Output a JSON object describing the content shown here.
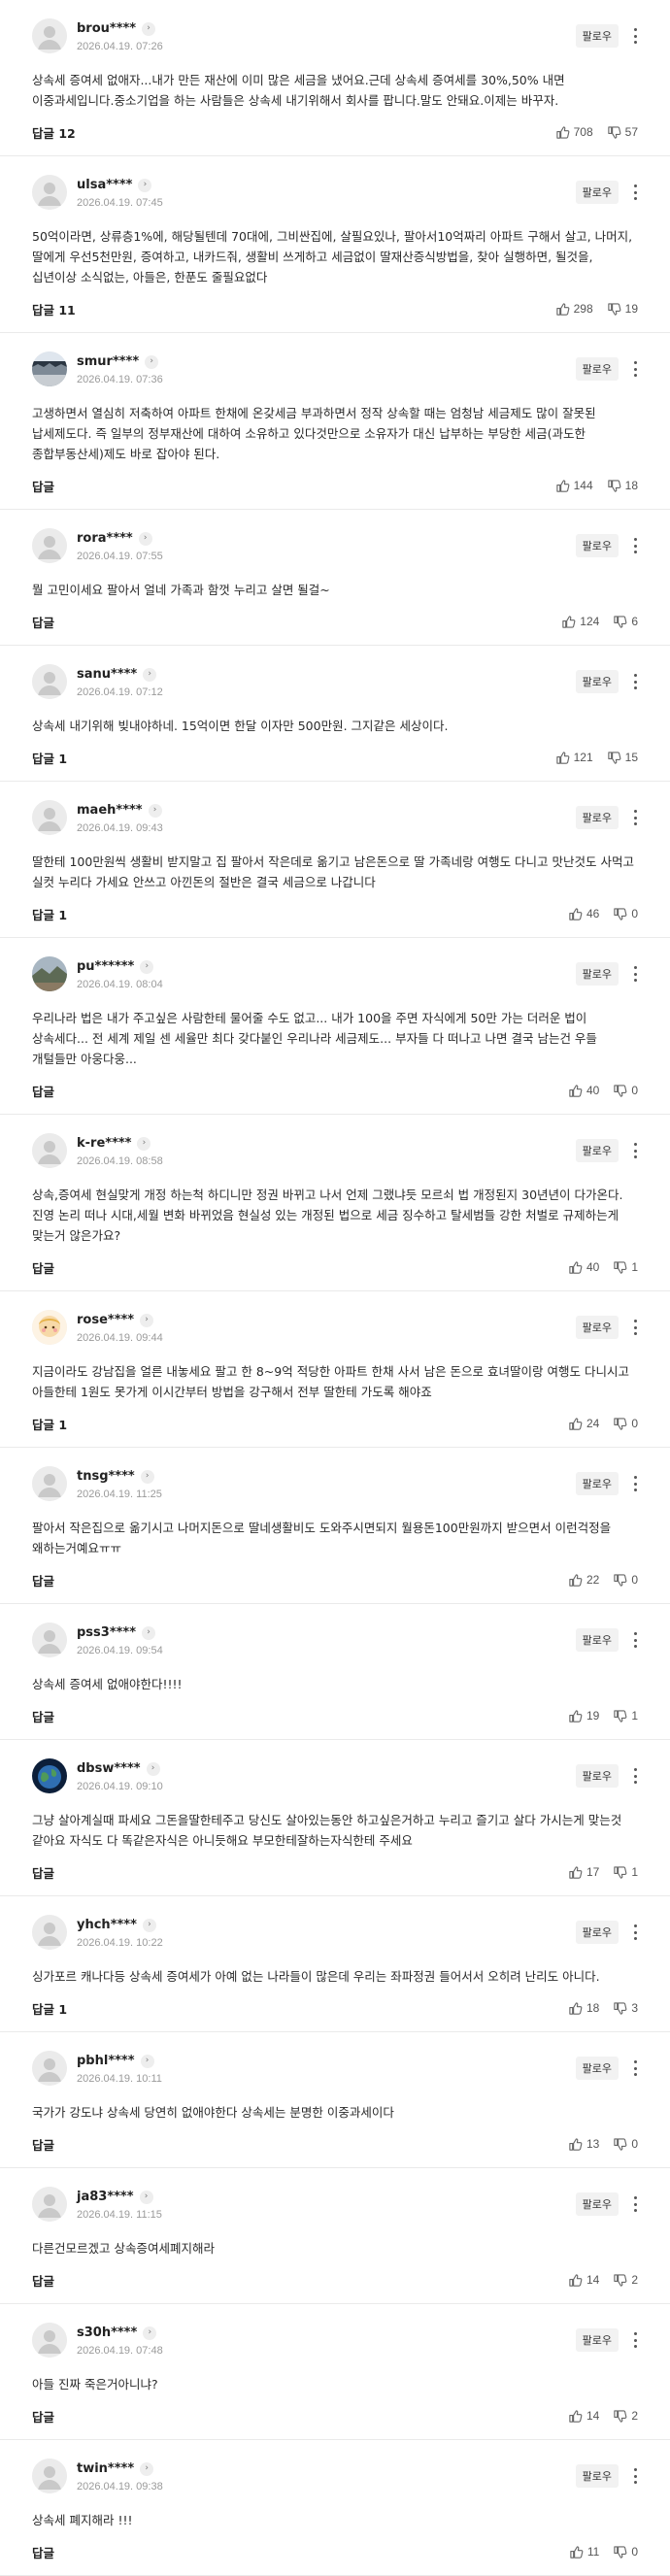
{
  "ui": {
    "follow_label": "팔로우",
    "reply_label": "답글",
    "chevron_glyph": "›"
  },
  "comments": [
    {
      "username": "brou****",
      "date": "2026.04.19. 07:26",
      "avatar": "default",
      "text": "상속세 증여세 없애자...내가 만든 재산에 이미 많은 세금을 냈어요.근데 상속세 증여세를 30%,50% 내면 이중과세입니다.중소기업을 하는 사람들은 상속세 내기위해서 회사를 팝니다.말도 안돼요.이제는 바꾸자.",
      "reply": "답글 12",
      "likes": "708",
      "dislikes": "57"
    },
    {
      "username": "ulsa****",
      "date": "2026.04.19. 07:45",
      "avatar": "default",
      "text": "50억이라면, 상류층1%에, 해당될텐데 70대에, 그비싼집에, 살필요있나, 팔아서10억짜리 아파트 구해서 살고, 나머지, 딸에게 우선5천만원, 증여하고, 내카드줘, 생활비 쓰게하고 세금없이 딸재산증식방법을, 찾아 실행하면, 될것을, 십년이상 소식없는, 아들은, 한푼도 줄필요없다",
      "reply": "답글 11",
      "likes": "298",
      "dislikes": "19"
    },
    {
      "username": "smur****",
      "date": "2026.04.19. 07:36",
      "avatar": "landscape",
      "text": "고생하면서 열심히 저축하여 아파트 한채에 온갖세금 부과하면서 정작 상속할 때는 엄청남 세금제도 많이 잘못된 납세제도다. 즉 일부의 정부재산에 대하여 소유하고 있다것만으로 소유자가 대신 납부하는 부당한 세금(과도한 종합부동산세)제도 바로 잡아야 된다.",
      "reply": "답글",
      "likes": "144",
      "dislikes": "18"
    },
    {
      "username": "rora****",
      "date": "2026.04.19. 07:55",
      "avatar": "default",
      "text": "뭘 고민이세요 팔아서 얼네 가족과 함껏 누리고 살면 될걸~",
      "reply": "답글",
      "likes": "124",
      "dislikes": "6"
    },
    {
      "username": "sanu****",
      "date": "2026.04.19. 07:12",
      "avatar": "default",
      "text": "상속세 내기위해 빚내야하네. 15억이면 한달 이자만 500만원. 그지같은 세상이다.",
      "reply": "답글 1",
      "likes": "121",
      "dislikes": "15"
    },
    {
      "username": "maeh****",
      "date": "2026.04.19. 09:43",
      "avatar": "default",
      "text": "딸한테 100만원씩 생활비 받지말고 집 팔아서 작은데로 옮기고 남은돈으로 딸 가족네랑 여행도 다니고 맛난것도 사먹고 실컷 누리다 가세요 안쓰고 아낀돈의 절반은 결국 세금으로 나갑니다",
      "reply": "답글 1",
      "likes": "46",
      "dislikes": "0"
    },
    {
      "username": "pu******",
      "date": "2026.04.19. 08:04",
      "avatar": "landscape2",
      "text": "우리나라 법은 내가 주고싶은 사람한테 물어줄 수도 없고... 내가 100을 주면 자식에게 50만 가는 더러운 법이 상속세다... 전 세계 제일 센 세율만 최다 갖다붙인 우리나라 세금제도... 부자들 다 떠나고 나면 결국 남는건 우들 개털들만 아웅다웅...",
      "reply": "답글",
      "likes": "40",
      "dislikes": "0"
    },
    {
      "username": "k-re****",
      "date": "2026.04.19. 08:58",
      "avatar": "default",
      "text": "상속,증여세 현실맞게 개정 하는척 하디니만 정권 바뀌고 나서 언제 그랬냐듯 모르쇠 법 개정된지 30년년이 다가온다. 진영 논리 떠나 시대,세월 변화 바뀌었음 현실성 있는 개정된 법으로 세금 징수하고 탈세범들 강한 처벌로 규제하는게 맞는거 않은가요?",
      "reply": "답글",
      "likes": "40",
      "dislikes": "1"
    },
    {
      "username": "rose****",
      "date": "2026.04.19. 09:44",
      "avatar": "cartoon",
      "text": "지금이라도 강남집을 얼른 내놓세요 팔고 한 8~9억 적당한 아파트 한채 사서 남은 돈으로 효녀딸이랑 여행도 다니시고 아들한테 1원도 못가게 이시간부터 방법을 강구해서 전부 딸한테 가도록 해야죠",
      "reply": "답글 1",
      "likes": "24",
      "dislikes": "0"
    },
    {
      "username": "tnsg****",
      "date": "2026.04.19. 11:25",
      "avatar": "default",
      "text": "팔아서 작은집으로 옮기시고 나머지돈으로 딸네생활비도 도와주시면되지 월용돈100만원까지 받으면서 이런걱정을 왜하는거예요ㅠㅠ",
      "reply": "답글",
      "likes": "22",
      "dislikes": "0"
    },
    {
      "username": "pss3****",
      "date": "2026.04.19. 09:54",
      "avatar": "default",
      "text": "상속세 증여세 없애야한다!!!!",
      "reply": "답글",
      "likes": "19",
      "dislikes": "1"
    },
    {
      "username": "dbsw****",
      "date": "2026.04.19. 09:10",
      "avatar": "earth",
      "text": "그냥 살아계실때 파세요 그돈을딸한테주고 당신도 살아있는동안 하고싶은거하고 누리고 즐기고 살다 가시는게 맞는것 같아요 자식도 다 똑같은자식은 아니듯해요 부모한테잘하는자식한테 주세요",
      "reply": "답글",
      "likes": "17",
      "dislikes": "1"
    },
    {
      "username": "yhch****",
      "date": "2026.04.19. 10:22",
      "avatar": "default",
      "text": "싱가포르 캐나다등 상속세 증여세가 아예 없는 나라들이 많은데 우리는 좌파정권 들어서서 오히려 난리도 아니다.",
      "reply": "답글 1",
      "likes": "18",
      "dislikes": "3"
    },
    {
      "username": "pbhl****",
      "date": "2026.04.19. 10:11",
      "avatar": "default",
      "text": "국가가 강도냐 상속세 당연히 없애야한다 상속세는 분명한 이중과세이다",
      "reply": "답글",
      "likes": "13",
      "dislikes": "0"
    },
    {
      "username": "ja83****",
      "date": "2026.04.19. 11:15",
      "avatar": "default",
      "text": "다른건모르겠고 상속증여세폐지해라",
      "reply": "답글",
      "likes": "14",
      "dislikes": "2"
    },
    {
      "username": "s30h****",
      "date": "2026.04.19. 07:48",
      "avatar": "default",
      "text": "아들 진짜 죽은거아니냐?",
      "reply": "답글",
      "likes": "14",
      "dislikes": "2"
    },
    {
      "username": "twin****",
      "date": "2026.04.19. 09:38",
      "avatar": "default",
      "text": "상속세 폐지해라 !!!",
      "reply": "답글",
      "likes": "11",
      "dislikes": "0"
    }
  ]
}
